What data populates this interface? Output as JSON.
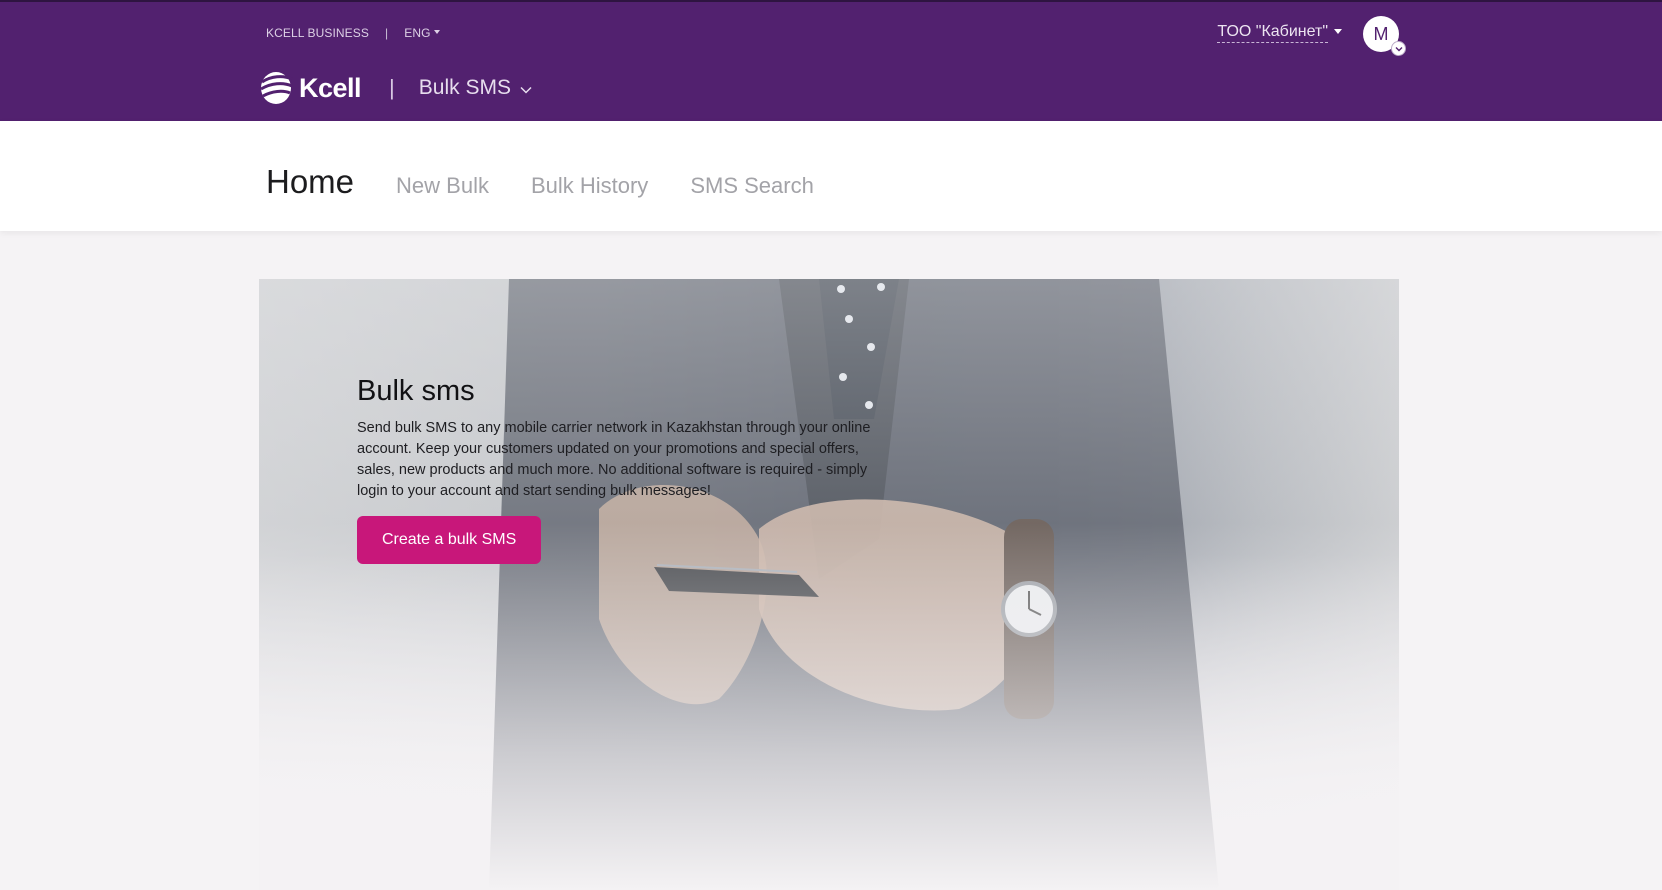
{
  "colors": {
    "header_bg": "#52216f",
    "accent": "#c8177a",
    "page_bg": "#f5f3f5"
  },
  "topbar": {
    "business_label": "KCELL BUSINESS",
    "separator": "|",
    "language": "ENG",
    "logo_text": "Kcell",
    "product_label": "Bulk SMS",
    "account_name": "ТОО \"Кабинет\"",
    "avatar_initial": "M"
  },
  "nav": {
    "tabs": [
      {
        "label": "Home",
        "active": true
      },
      {
        "label": "New Bulk",
        "active": false
      },
      {
        "label": "Bulk History",
        "active": false
      },
      {
        "label": "SMS Search",
        "active": false
      }
    ]
  },
  "hero": {
    "title": "Bulk sms",
    "text": "Send bulk SMS to any mobile carrier network in Kazakhstan through your online account. Keep your customers updated on your promotions and special offers, sales, new products and much more. No additional software is required - simply login to your account and start sending bulk messages!",
    "button_label": "Create a bulk SMS"
  },
  "icons": {
    "logo": "kcell-logo-icon",
    "product_dropdown": "chevron-down-icon",
    "avatar_badge": "chevron-down-icon"
  }
}
